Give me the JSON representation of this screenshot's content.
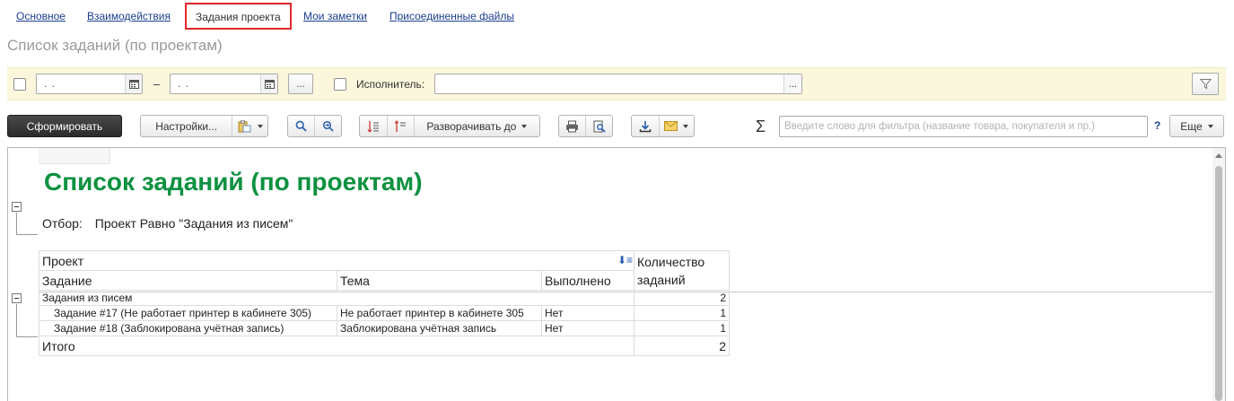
{
  "tabs": [
    {
      "label": "Основное"
    },
    {
      "label": "Взаимодействия"
    },
    {
      "label": "Задания проекта"
    },
    {
      "label": "Мои заметки"
    },
    {
      "label": "Присоединенные файлы"
    }
  ],
  "page_title": "Список заданий (по проектам)",
  "filter": {
    "period_from": ". .",
    "period_dash": "–",
    "period_to": ". .",
    "period_button": "...",
    "executor_label": "Исполнитель:",
    "executor_value": "",
    "executor_button": "..."
  },
  "toolbar": {
    "generate": "Сформировать",
    "settings": "Настройки...",
    "expand_to": "Разворачивать до",
    "sigma": "Σ",
    "search_placeholder": "Введите слово для фильтра (название товара, покупателя и пр.)",
    "help": "?",
    "more": "Еще"
  },
  "report": {
    "title": "Список заданий (по проектам)",
    "filter_label": "Отбор:",
    "filter_value": "Проект Равно \"Задания из писем\"",
    "headers": {
      "project": "Проект",
      "task": "Задание",
      "topic": "Тема",
      "done": "Выполнено",
      "count_line1": "Количество",
      "count_line2": "заданий"
    },
    "group": {
      "name": "Задания из писем",
      "count": "2"
    },
    "rows": [
      {
        "task": "Задание #17 (Не работает принтер в кабинете 305)",
        "topic": "Не работает принтер в кабинете 305",
        "done": "Нет",
        "count": "1"
      },
      {
        "task": "Задание #18 (Заблокирована учётная запись)",
        "topic": "Заблокирована учётная запись",
        "done": "Нет",
        "count": "1"
      }
    ],
    "total": {
      "label": "Итого",
      "count": "2"
    }
  },
  "colors": {
    "title_green": "#0c9140",
    "tab_highlight": "#e0262a",
    "filter_bg": "#fbf7dc",
    "link": "#1a3e8f"
  }
}
